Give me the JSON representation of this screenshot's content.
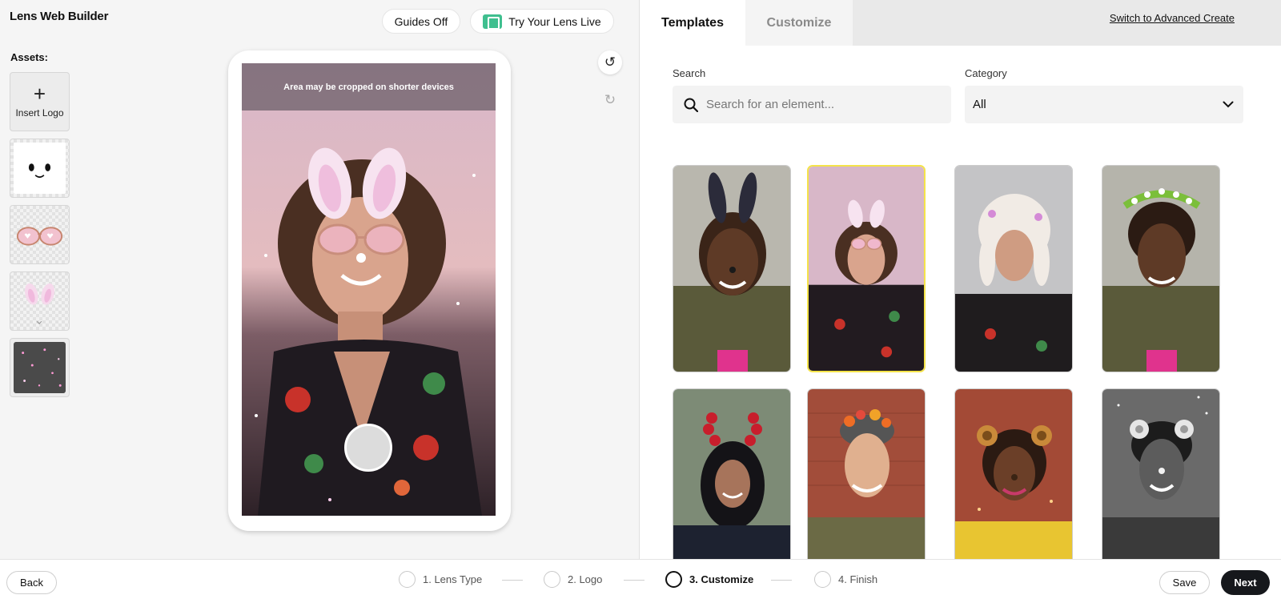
{
  "app": {
    "title": "Lens Web Builder"
  },
  "assets": {
    "label": "Assets:",
    "insert_logo_label": "Insert Logo",
    "items": [
      {
        "name": "face-sticker",
        "kind": "image"
      },
      {
        "name": "heart-glasses",
        "kind": "image"
      },
      {
        "name": "bunny-ears",
        "kind": "image"
      },
      {
        "name": "sparkles",
        "kind": "image"
      }
    ]
  },
  "preview": {
    "guides_label": "Guides Off",
    "try_live_label": "Try Your Lens Live",
    "crop_notice": "Area may be cropped on shorter devices",
    "undo_icon": "undo-icon",
    "redo_icon": "redo-icon"
  },
  "right_panel": {
    "tabs": [
      {
        "label": "Templates",
        "active": true
      },
      {
        "label": "Customize",
        "active": false
      }
    ],
    "advanced_link": "Switch to Advanced Create",
    "search": {
      "label": "Search",
      "placeholder": "Search for an element...",
      "value": ""
    },
    "category": {
      "label": "Category",
      "value": "All"
    },
    "templates": [
      {
        "name": "dark-bunny-ears",
        "selected": false
      },
      {
        "name": "pink-bunny-heart-glasses",
        "selected": true
      },
      {
        "name": "white-wig",
        "selected": false
      },
      {
        "name": "flower-crown",
        "selected": false
      },
      {
        "name": "red-rose-ears",
        "selected": false
      },
      {
        "name": "orange-flower-crown",
        "selected": false
      },
      {
        "name": "leopard-ears",
        "selected": false
      },
      {
        "name": "bw-bear-ears",
        "selected": false
      }
    ]
  },
  "footer": {
    "back_label": "Back",
    "steps": [
      {
        "label": "1. Lens Type",
        "current": false
      },
      {
        "label": "2. Logo",
        "current": false
      },
      {
        "label": "3. Customize",
        "current": true
      },
      {
        "label": "4. Finish",
        "current": false
      }
    ],
    "save_label": "Save",
    "next_label": "Next"
  },
  "colors": {
    "selected_border": "#f4e34a",
    "next_button": "#16181c",
    "try_icon": "#3fbf8f"
  }
}
